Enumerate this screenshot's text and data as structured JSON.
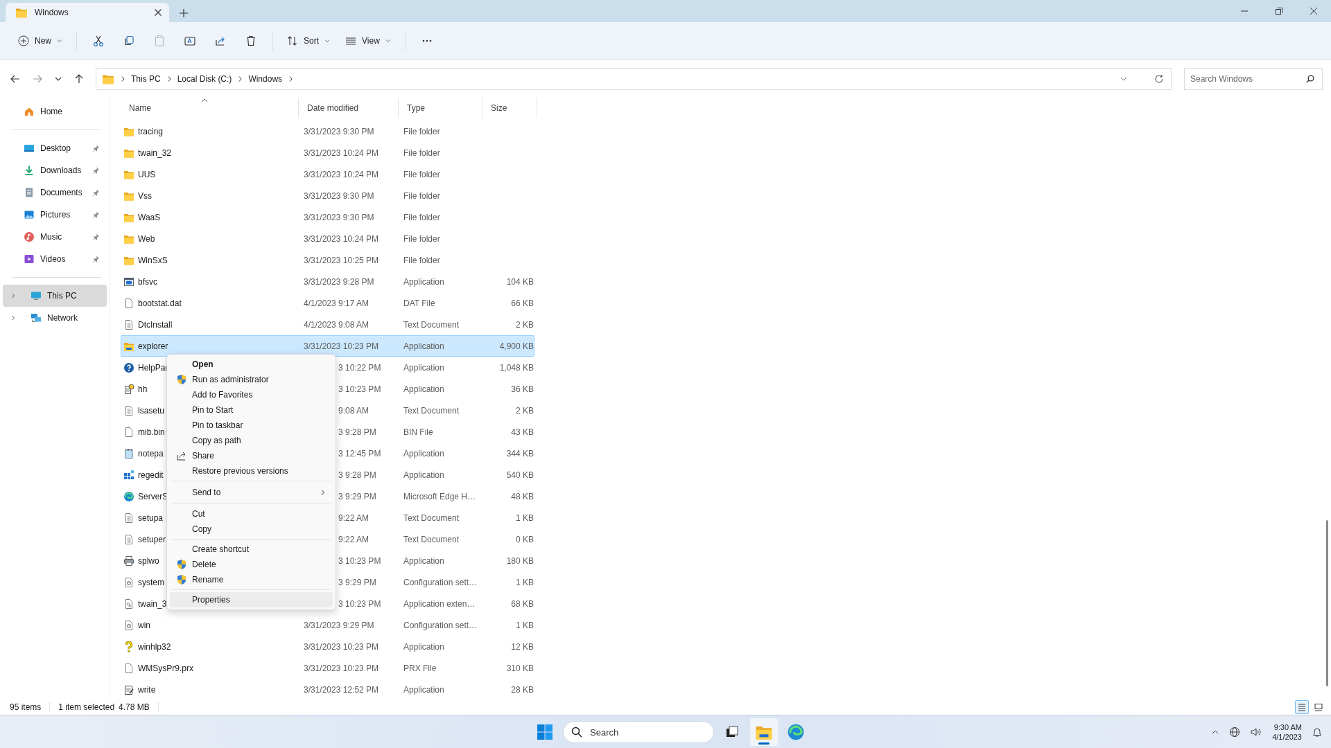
{
  "window": {
    "tab_title": "Windows"
  },
  "toolbar": {
    "new": {
      "label": "New"
    },
    "paste": {
      "disabled": true
    },
    "sort": {
      "label": "Sort"
    },
    "view": {
      "label": "View"
    }
  },
  "address_bar": {
    "breadcrumbs": [
      "This PC",
      "Local Disk (C:)",
      "Windows"
    ],
    "search": {
      "placeholder": "Search Windows"
    }
  },
  "sidebar": {
    "sections": [
      {
        "items": [
          {
            "label": "Home",
            "kind": "home",
            "selected": false
          }
        ]
      },
      {
        "items": [
          {
            "label": "Desktop",
            "kind": "desktop",
            "pinned": true,
            "selected": false
          },
          {
            "label": "Downloads",
            "kind": "downloads",
            "pinned": true,
            "selected": false
          },
          {
            "label": "Documents",
            "kind": "documents",
            "pinned": true,
            "selected": false
          },
          {
            "label": "Pictures",
            "kind": "pictures",
            "pinned": true,
            "selected": false
          },
          {
            "label": "Music",
            "kind": "music",
            "pinned": true,
            "selected": false
          },
          {
            "label": "Videos",
            "kind": "videos",
            "pinned": true,
            "selected": false
          }
        ]
      },
      {
        "items": [
          {
            "label": "This PC",
            "kind": "pc",
            "expanded": false,
            "selected": true
          },
          {
            "label": "Network",
            "kind": "network",
            "expanded": false,
            "selected": false
          }
        ]
      }
    ]
  },
  "file_list": {
    "columns": [
      {
        "label": "Name",
        "sorted": true
      },
      {
        "label": "Date modified",
        "sorted": false
      },
      {
        "label": "Type",
        "sorted": false
      },
      {
        "label": "Size",
        "sorted": false
      }
    ],
    "rows": [
      {
        "name": "tracing",
        "kind": "folder",
        "date": "3/31/2023 9:30 PM",
        "type": "File folder",
        "size": "",
        "selected": false
      },
      {
        "name": "twain_32",
        "kind": "folder",
        "date": "3/31/2023 10:24 PM",
        "type": "File folder",
        "size": "",
        "selected": false
      },
      {
        "name": "UUS",
        "kind": "folder",
        "date": "3/31/2023 10:24 PM",
        "type": "File folder",
        "size": "",
        "selected": false
      },
      {
        "name": "Vss",
        "kind": "folder",
        "date": "3/31/2023 9:30 PM",
        "type": "File folder",
        "size": "",
        "selected": false
      },
      {
        "name": "WaaS",
        "kind": "folder",
        "date": "3/31/2023 9:30 PM",
        "type": "File folder",
        "size": "",
        "selected": false
      },
      {
        "name": "Web",
        "kind": "folder",
        "date": "3/31/2023 10:24 PM",
        "type": "File folder",
        "size": "",
        "selected": false
      },
      {
        "name": "WinSxS",
        "kind": "folder",
        "date": "3/31/2023 10:25 PM",
        "type": "File folder",
        "size": "",
        "selected": false
      },
      {
        "name": "bfsvc",
        "kind": "app",
        "date": "3/31/2023 9:28 PM",
        "type": "Application",
        "size": "104 KB",
        "selected": false
      },
      {
        "name": "bootstat.dat",
        "kind": "file",
        "date": "4/1/2023 9:17 AM",
        "type": "DAT File",
        "size": "66 KB",
        "selected": false
      },
      {
        "name": "DtcInstall",
        "kind": "text",
        "date": "4/1/2023 9:08 AM",
        "type": "Text Document",
        "size": "2 KB",
        "selected": false
      },
      {
        "name": "explorer",
        "kind": "explorer",
        "date": "3/31/2023 10:23 PM",
        "type": "Application",
        "size": "4,900 KB",
        "selected": true
      },
      {
        "name": "HelpPar",
        "kind": "help",
        "date_visible_part": "3 10:22 PM",
        "type": "Application",
        "size": "1,048 KB",
        "selected": false
      },
      {
        "name": "hh",
        "kind": "hh",
        "date_visible_part": "3 10:23 PM",
        "type": "Application",
        "size": "36 KB",
        "selected": false
      },
      {
        "name": "lsasetu",
        "kind": "text",
        "date_visible_part": "9:08 AM",
        "type": "Text Document",
        "size": "2 KB",
        "selected": false
      },
      {
        "name": "mib.bin",
        "kind": "file",
        "date_visible_part": "3 9:28 PM",
        "type": "BIN File",
        "size": "43 KB",
        "selected": false
      },
      {
        "name": "notepa",
        "kind": "notepad",
        "date_visible_part": "3 12:45 PM",
        "type": "Application",
        "size": "344 KB",
        "selected": false
      },
      {
        "name": "regedit",
        "kind": "regedit",
        "date_visible_part": "3 9:28 PM",
        "type": "Application",
        "size": "540 KB",
        "selected": false
      },
      {
        "name": "ServerS",
        "kind": "edge",
        "date_visible_part": "3 9:29 PM",
        "type": "Microsoft Edge H…",
        "size": "48 KB",
        "selected": false
      },
      {
        "name": "setupa",
        "kind": "text",
        "date_visible_part": "9:22 AM",
        "type": "Text Document",
        "size": "1 KB",
        "selected": false
      },
      {
        "name": "setuper",
        "kind": "text",
        "date_visible_part": "9:22 AM",
        "type": "Text Document",
        "size": "0 KB",
        "selected": false
      },
      {
        "name": "splwo",
        "kind": "printer",
        "date_visible_part": "3 10:23 PM",
        "type": "Application",
        "size": "180 KB",
        "selected": false
      },
      {
        "name": "system",
        "kind": "config",
        "date_visible_part": "3 9:29 PM",
        "type": "Configuration sett…",
        "size": "1 KB",
        "selected": false
      },
      {
        "name": "twain_3",
        "kind": "extension",
        "date_visible_part": "3 10:23 PM",
        "type": "Application exten…",
        "size": "68 KB",
        "selected": false
      },
      {
        "name": "win",
        "kind": "config",
        "date": "3/31/2023 9:29 PM",
        "type": "Configuration sett…",
        "size": "1 KB",
        "selected": false
      },
      {
        "name": "winhlp32",
        "kind": "question",
        "date": "3/31/2023 10:23 PM",
        "type": "Application",
        "size": "12 KB",
        "selected": false
      },
      {
        "name": "WMSysPr9.prx",
        "kind": "file",
        "date": "3/31/2023 10:23 PM",
        "type": "PRX File",
        "size": "310 KB",
        "selected": false
      },
      {
        "name": "write",
        "kind": "write",
        "date": "3/31/2023 12:52 PM",
        "type": "Application",
        "size": "28 KB",
        "selected": false
      }
    ]
  },
  "context_menu": {
    "groups": [
      {
        "items": [
          {
            "label": "Open",
            "kind": "default",
            "selected": false
          },
          {
            "label": "Run as administrator",
            "kind": "admin",
            "selected": false
          },
          {
            "label": "Add to Favorites",
            "kind": "plain",
            "selected": false
          },
          {
            "label": "Pin to Start",
            "kind": "plain",
            "selected": false
          },
          {
            "label": "Pin to taskbar",
            "kind": "plain",
            "selected": false
          },
          {
            "label": "Copy as path",
            "kind": "plain",
            "selected": false
          },
          {
            "label": "Share",
            "kind": "share",
            "selected": false
          },
          {
            "label": "Restore previous versions",
            "kind": "plain",
            "selected": false
          }
        ]
      },
      {
        "items": [
          {
            "label": "Send to",
            "kind": "submenu",
            "selected": false
          }
        ]
      },
      {
        "items": [
          {
            "label": "Cut",
            "kind": "plain",
            "selected": false
          },
          {
            "label": "Copy",
            "kind": "plain",
            "selected": false
          }
        ]
      },
      {
        "items": [
          {
            "label": "Create shortcut",
            "kind": "plain",
            "selected": false
          },
          {
            "label": "Delete",
            "kind": "admin",
            "selected": false
          },
          {
            "label": "Rename",
            "kind": "admin",
            "selected": false
          }
        ]
      },
      {
        "items": [
          {
            "label": "Properties",
            "kind": "plain",
            "selected": true
          }
        ]
      }
    ]
  },
  "status_bar": {
    "item_count": "95 items",
    "selection": "1 item selected",
    "selection_size": "4.78 MB"
  },
  "view_toggles": [
    {
      "kind": "details",
      "selected": true
    },
    {
      "kind": "tiles",
      "selected": false
    }
  ],
  "taskbar": {
    "search": {
      "placeholder": "Search"
    },
    "apps": [
      {
        "kind": "taskview",
        "active": false
      },
      {
        "kind": "explorer",
        "active": true
      },
      {
        "kind": "edge",
        "active": false
      }
    ],
    "clock": {
      "time": "9:30 AM",
      "date": "4/1/2023"
    }
  }
}
